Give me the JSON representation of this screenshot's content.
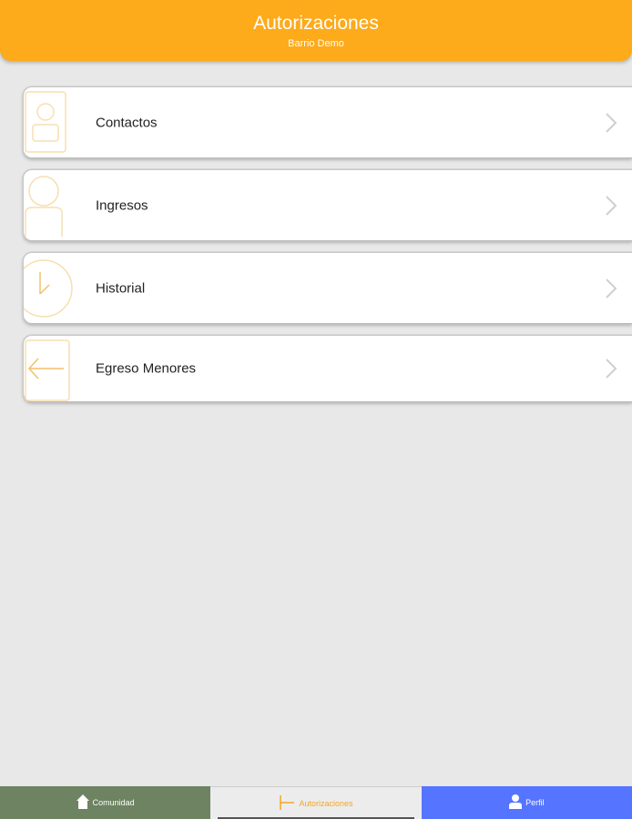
{
  "header": {
    "title": "Autorizaciones",
    "subtitle": "Barrio Demo",
    "color": "#fdaa1b"
  },
  "menu": {
    "items": [
      {
        "label": "Contactos",
        "icon": "contact-card-icon"
      },
      {
        "label": "Ingresos",
        "icon": "person-icon"
      },
      {
        "label": "Historial",
        "icon": "clock-icon"
      },
      {
        "label": "Egreso Menores",
        "icon": "exit-door-icon"
      }
    ]
  },
  "tabbar": {
    "tabs": [
      {
        "label": "Comunidad",
        "icon": "home-icon",
        "color": "#6d8361"
      },
      {
        "label": "Autorizaciones",
        "icon": "gate-icon",
        "color": "#ececec",
        "active": true
      },
      {
        "label": "Perfil",
        "icon": "user-icon",
        "color": "#5574ff"
      }
    ]
  }
}
